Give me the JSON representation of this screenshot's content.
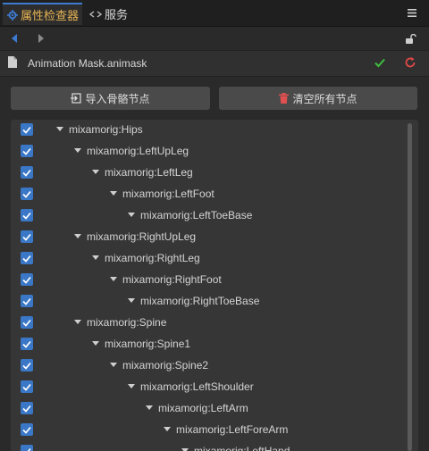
{
  "tabs": [
    {
      "label": "属性检查器",
      "icon": "gear-icon",
      "active": true
    },
    {
      "label": "服务",
      "icon": "link-icon",
      "active": false
    }
  ],
  "file": {
    "name": "Animation Mask.animask"
  },
  "actions": {
    "import_label": "导入骨骼节点",
    "clear_label": "清空所有节点"
  },
  "colors": {
    "accent": "#3a77c6",
    "tab_active_text": "#e6b352",
    "ok": "#3fbf3f",
    "revert": "#e04848",
    "danger": "#e05050"
  },
  "tree": [
    {
      "label": "mixamorig:Hips",
      "depth": 0,
      "checked": true,
      "expanded": true
    },
    {
      "label": "mixamorig:LeftUpLeg",
      "depth": 1,
      "checked": true,
      "expanded": true
    },
    {
      "label": "mixamorig:LeftLeg",
      "depth": 2,
      "checked": true,
      "expanded": true
    },
    {
      "label": "mixamorig:LeftFoot",
      "depth": 3,
      "checked": true,
      "expanded": true
    },
    {
      "label": "mixamorig:LeftToeBase",
      "depth": 4,
      "checked": true,
      "expanded": true
    },
    {
      "label": "mixamorig:RightUpLeg",
      "depth": 1,
      "checked": true,
      "expanded": true
    },
    {
      "label": "mixamorig:RightLeg",
      "depth": 2,
      "checked": true,
      "expanded": true
    },
    {
      "label": "mixamorig:RightFoot",
      "depth": 3,
      "checked": true,
      "expanded": true
    },
    {
      "label": "mixamorig:RightToeBase",
      "depth": 4,
      "checked": true,
      "expanded": true
    },
    {
      "label": "mixamorig:Spine",
      "depth": 1,
      "checked": true,
      "expanded": true
    },
    {
      "label": "mixamorig:Spine1",
      "depth": 2,
      "checked": true,
      "expanded": true
    },
    {
      "label": "mixamorig:Spine2",
      "depth": 3,
      "checked": true,
      "expanded": true
    },
    {
      "label": "mixamorig:LeftShoulder",
      "depth": 4,
      "checked": true,
      "expanded": true
    },
    {
      "label": "mixamorig:LeftArm",
      "depth": 5,
      "checked": true,
      "expanded": true
    },
    {
      "label": "mixamorig:LeftForeArm",
      "depth": 6,
      "checked": true,
      "expanded": true
    },
    {
      "label": "mixamorig:LeftHand",
      "depth": 7,
      "checked": true,
      "expanded": true
    }
  ]
}
